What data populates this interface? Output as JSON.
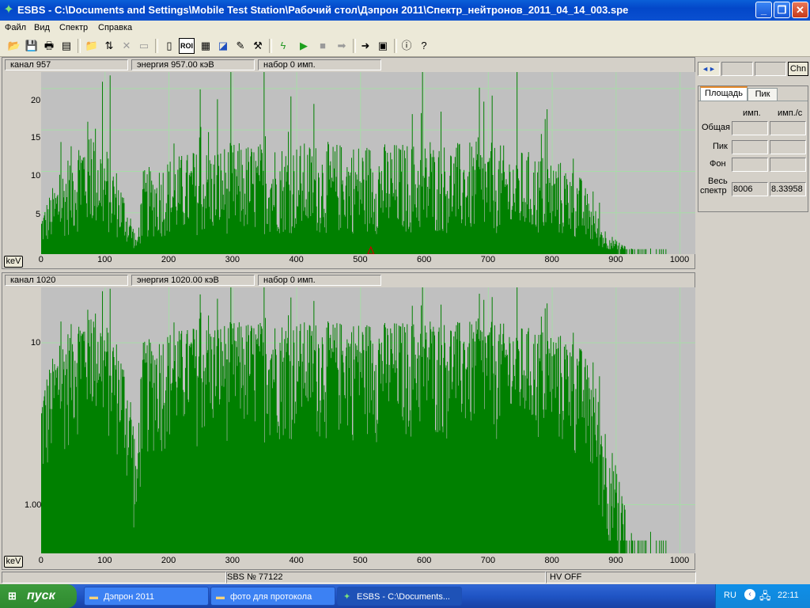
{
  "window": {
    "title": "ESBS - C:\\Documents and Settings\\Mobile Test Station\\Рабочий стол\\Дэпрон 2011\\Спектр_нейтронов_2011_04_14_003.spe",
    "min_label": "_",
    "max_label": "❐",
    "close_label": "✕"
  },
  "menu": [
    "Файл",
    "Вид",
    "Спектр",
    "Справка"
  ],
  "toolbar": {
    "icons": [
      "open-icon",
      "save-icon",
      "print-icon",
      "print-setup-icon",
      "open-folder-icon",
      "refresh-icon",
      "delete-icon",
      "disabled-icon",
      "report-icon",
      "roi-icon",
      "table-icon",
      "calibrate-icon",
      "edit-icon",
      "tools-icon",
      "run-device-icon",
      "play-icon",
      "stop-icon",
      "forward-icon",
      "export-icon",
      "import-icon",
      "info-icon",
      "help-icon"
    ],
    "roi_label": "ROI"
  },
  "top_panel": {
    "channel": "канал 957",
    "energy": "энергия 957.00 кэВ",
    "counts": "набор     0 имп.",
    "kev_button": "keV",
    "y_ticks": [
      "5",
      "10",
      "15",
      "20"
    ],
    "x_ticks": [
      "0",
      "100",
      "200",
      "300",
      "400",
      "500",
      "600",
      "700",
      "800",
      "900",
      "1000"
    ]
  },
  "bottom_panel": {
    "channel": "канал 1020",
    "energy": "энергия 1020.00 кэВ",
    "counts": "набор     0 имп.",
    "kev_button": "keV",
    "y_ticks": [
      "1.00",
      "10"
    ],
    "x_ticks": [
      "0",
      "100",
      "200",
      "300",
      "400",
      "500",
      "600",
      "700",
      "800",
      "900",
      "1000"
    ]
  },
  "right_panel": {
    "nav_left": "◄",
    "nav_right": "►",
    "chn_button": "Chn",
    "tabs": [
      "Площадь",
      "Пик"
    ],
    "col_counts": "имп.",
    "col_rate": "имп./с",
    "row_total": "Общая",
    "row_peak": "Пик",
    "row_bg": "Фон",
    "row_spectrum_1": "Весь",
    "row_spectrum_2": "спектр",
    "spectrum_counts": "8006",
    "spectrum_rate": "8.33958"
  },
  "status": {
    "serial": "SBS № 77122",
    "hv": "HV OFF"
  },
  "taskbar": {
    "start": "пуск",
    "tasks": [
      "Дэпрон 2011",
      "фото для протокола",
      "ESBS - C:\\Documents..."
    ],
    "lang": "RU",
    "time": "22:11"
  },
  "colors": {
    "bar": "#008000",
    "plot_bg": "#c0c0c0",
    "grid": "#a8dca8",
    "marker": "#cc0000"
  },
  "chart_data": [
    {
      "type": "bar",
      "title": "",
      "xlabel": "keV",
      "ylabel": "",
      "xlim": [
        0,
        1024
      ],
      "ylim": [
        0,
        22
      ],
      "y_scale": "linear",
      "marker_x": 500,
      "envelope_x": [
        0,
        20,
        40,
        60,
        80,
        100,
        120,
        140,
        150,
        160,
        200,
        300,
        400,
        500,
        600,
        700,
        800,
        840,
        860,
        880,
        900,
        920,
        940,
        960,
        1000
      ],
      "envelope_y": [
        3,
        5,
        7,
        9,
        10,
        8,
        6,
        3,
        1,
        6,
        7,
        8,
        8,
        8,
        8,
        8,
        7,
        6,
        4,
        2,
        1,
        0.5,
        0.3,
        0.2,
        0
      ]
    },
    {
      "type": "bar",
      "title": "",
      "xlabel": "keV",
      "ylabel": "",
      "xlim": [
        0,
        1024
      ],
      "ylim": [
        0.5,
        22
      ],
      "y_scale": "log",
      "envelope_x": [
        0,
        20,
        40,
        60,
        80,
        100,
        120,
        140,
        150,
        160,
        200,
        300,
        400,
        500,
        600,
        700,
        800,
        840,
        860,
        880,
        900,
        920,
        940,
        960,
        1000
      ],
      "envelope_y": [
        3,
        5,
        7,
        9,
        10,
        8,
        6,
        3,
        1,
        6,
        7,
        8,
        8,
        8,
        8,
        8,
        7,
        6,
        4,
        2,
        1,
        0.5,
        0.3,
        0.2,
        0
      ]
    }
  ]
}
